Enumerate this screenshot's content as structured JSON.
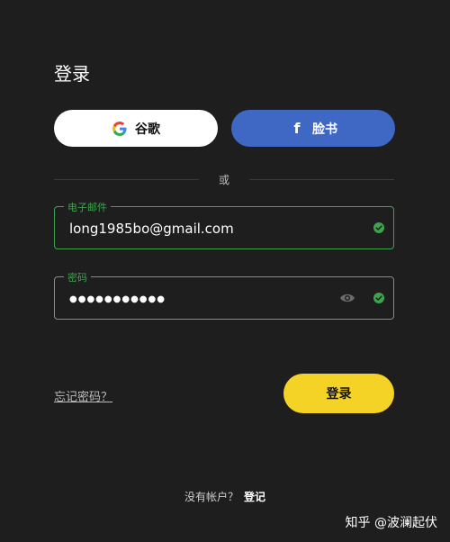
{
  "login": {
    "title": "登录",
    "social": {
      "google_label": "谷歌",
      "google_icon": "google-icon",
      "facebook_label": "脸书",
      "facebook_icon": "facebook-icon"
    },
    "divider_text": "或",
    "email": {
      "label": "电子邮件",
      "value": "long1985bo@gmail.com",
      "status": "valid"
    },
    "password": {
      "label": "密码",
      "value": "●●●●●●●●●●●",
      "status": "valid"
    },
    "forgot_label": "忘记密码？",
    "submit_label": "登录",
    "signup_prompt": "没有帐户？",
    "signup_link": "登记"
  },
  "watermark": "知乎 @波澜起伏",
  "colors": {
    "background": "#1e1e1f",
    "google_button": "#ffffff",
    "facebook_button": "#3f67c4",
    "valid_green": "#3fa34d",
    "submit_yellow": "#f5d326"
  }
}
